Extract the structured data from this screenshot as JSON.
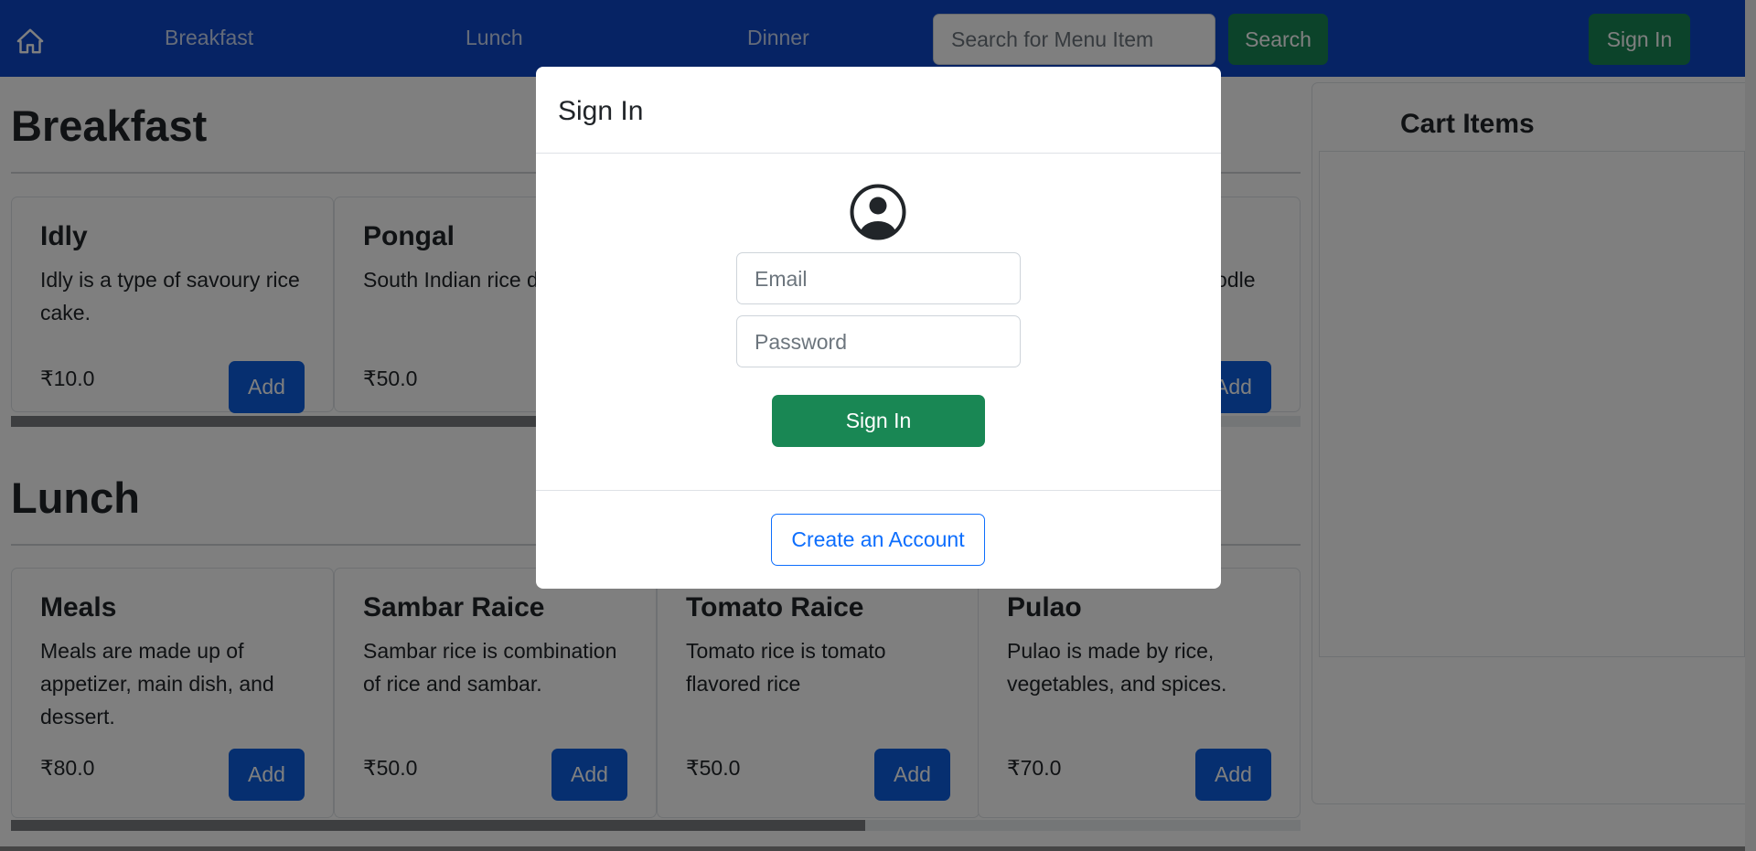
{
  "navbar": {
    "home_icon": "house-icon",
    "links": [
      "Breakfast",
      "Lunch",
      "Dinner"
    ],
    "search_placeholder": "Search for Menu Item",
    "search_button": "Search",
    "signin_button": "Sign In"
  },
  "sections": {
    "breakfast": {
      "title": "Breakfast",
      "items": [
        {
          "name": "Idly",
          "desc": "Idly is a type of savoury rice cake.",
          "price": "₹10.0",
          "add": "Add"
        },
        {
          "name": "Pongal",
          "desc": "South Indian rice d",
          "price": "₹50.0",
          "add": "Add"
        },
        {
          "name": "",
          "desc": "odle",
          "price": "",
          "add": "Add"
        }
      ]
    },
    "lunch": {
      "title": "Lunch",
      "items": [
        {
          "name": "Meals",
          "desc": "Meals are made up of appetizer, main dish, and dessert.",
          "price": "₹80.0",
          "add": "Add"
        },
        {
          "name": "Sambar Raice",
          "desc": "Sambar rice is combination of rice and sambar.",
          "price": "₹50.0",
          "add": "Add"
        },
        {
          "name": "Tomato Raice",
          "desc": "Tomato rice is tomato flavored rice",
          "price": "₹50.0",
          "add": "Add"
        },
        {
          "name": "Pulao",
          "desc": "Pulao is made by rice, vegetables, and spices.",
          "price": "₹70.0",
          "add": "Add"
        }
      ]
    }
  },
  "cart": {
    "title": "Cart Items"
  },
  "modal": {
    "title": "Sign In",
    "avatar_icon": "user-circle-icon",
    "email_placeholder": "Email",
    "password_placeholder": "Password",
    "signin_button": "Sign In",
    "create_account": "Create an Account"
  },
  "colors": {
    "navbar": "#0d47c8",
    "success": "#198754",
    "primary": "#0d5fe0"
  }
}
